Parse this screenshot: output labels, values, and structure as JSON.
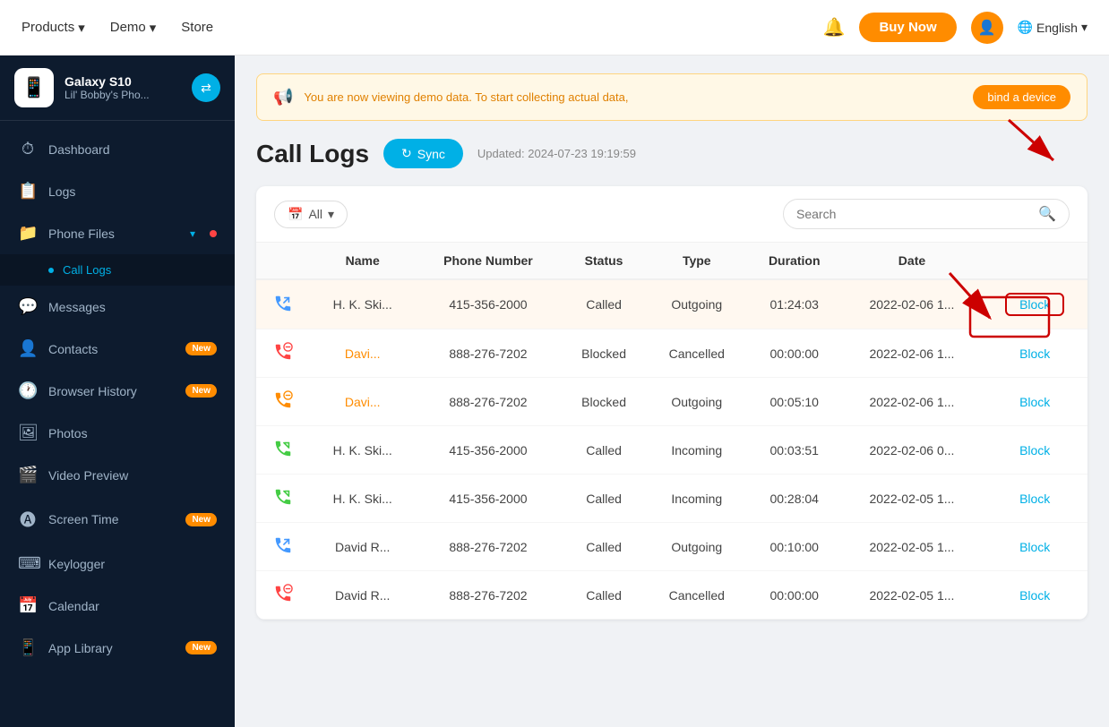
{
  "app": {
    "device_name": "Galaxy S10",
    "device_sub": "Lil' Bobby's Pho...",
    "switch_icon": "↔"
  },
  "top_nav": {
    "products_label": "Products",
    "demo_label": "Demo",
    "store_label": "Store",
    "buy_now_label": "Buy Now",
    "language_label": "English"
  },
  "sidebar": {
    "items": [
      {
        "id": "dashboard",
        "label": "Dashboard",
        "icon": "⏱",
        "badge": ""
      },
      {
        "id": "logs",
        "label": "Logs",
        "icon": "📋",
        "badge": ""
      },
      {
        "id": "phone-files",
        "label": "Phone Files",
        "icon": "📁",
        "badge": ""
      },
      {
        "id": "call-logs",
        "label": "Call Logs",
        "icon": "📞",
        "badge": "",
        "sub": true
      },
      {
        "id": "messages",
        "label": "Messages",
        "icon": "💬",
        "badge": ""
      },
      {
        "id": "contacts",
        "label": "Contacts",
        "icon": "👤",
        "badge": "New"
      },
      {
        "id": "browser-history",
        "label": "Browser History",
        "icon": "🕐",
        "badge": "New"
      },
      {
        "id": "photos",
        "label": "Photos",
        "icon": "🖼",
        "badge": ""
      },
      {
        "id": "video-preview",
        "label": "Video Preview",
        "icon": "🎬",
        "badge": ""
      },
      {
        "id": "screen-time",
        "label": "Screen Time",
        "icon": "🅐",
        "badge": "New"
      },
      {
        "id": "keylogger",
        "label": "Keylogger",
        "icon": "⌨",
        "badge": ""
      },
      {
        "id": "calendar",
        "label": "Calendar",
        "icon": "📅",
        "badge": ""
      },
      {
        "id": "app-library",
        "label": "App Library",
        "icon": "📱",
        "badge": "New"
      }
    ]
  },
  "demo_banner": {
    "text": "You are now viewing demo data. To start collecting actual data,",
    "bind_label": "bind a device"
  },
  "page": {
    "title": "Call Logs",
    "sync_label": "Sync",
    "updated_text": "Updated: 2024-07-23 19:19:59"
  },
  "toolbar": {
    "filter_label": "All",
    "search_placeholder": "Search"
  },
  "table": {
    "columns": [
      "Name",
      "Phone Number",
      "Status",
      "Type",
      "Duration",
      "Date",
      ""
    ],
    "rows": [
      {
        "icon": "outgoing_called",
        "name": "H. K. Ski...",
        "phone": "415-356-2000",
        "status": "Called",
        "type": "Outgoing",
        "duration": "01:24:03",
        "date": "2022-02-06 1...",
        "block": "Block",
        "highlighted": true,
        "name_blocked": false,
        "icon_color": "blue"
      },
      {
        "icon": "incoming_blocked",
        "name": "Davi...",
        "phone": "888-276-7202",
        "status": "Blocked",
        "type": "Cancelled",
        "duration": "00:00:00",
        "date": "2022-02-06 1...",
        "block": "Block",
        "highlighted": false,
        "name_blocked": true,
        "icon_color": "red"
      },
      {
        "icon": "outgoing_blocked",
        "name": "Davi...",
        "phone": "888-276-7202",
        "status": "Blocked",
        "type": "Outgoing",
        "duration": "00:05:10",
        "date": "2022-02-06 1...",
        "block": "Block",
        "highlighted": false,
        "name_blocked": true,
        "icon_color": "orange"
      },
      {
        "icon": "incoming_called",
        "name": "H. K. Ski...",
        "phone": "415-356-2000",
        "status": "Called",
        "type": "Incoming",
        "duration": "00:03:51",
        "date": "2022-02-06 0...",
        "block": "Block",
        "highlighted": false,
        "name_blocked": false,
        "icon_color": "green"
      },
      {
        "icon": "incoming_called",
        "name": "H. K. Ski...",
        "phone": "415-356-2000",
        "status": "Called",
        "type": "Incoming",
        "duration": "00:28:04",
        "date": "2022-02-05 1...",
        "block": "Block",
        "highlighted": false,
        "name_blocked": false,
        "icon_color": "green"
      },
      {
        "icon": "outgoing_called",
        "name": "David R...",
        "phone": "888-276-7202",
        "status": "Called",
        "type": "Outgoing",
        "duration": "00:10:00",
        "date": "2022-02-05 1...",
        "block": "Block",
        "highlighted": false,
        "name_blocked": false,
        "icon_color": "blue"
      },
      {
        "icon": "incoming_blocked",
        "name": "David R...",
        "phone": "888-276-7202",
        "status": "Called",
        "type": "Cancelled",
        "duration": "00:00:00",
        "date": "2022-02-05 1...",
        "block": "Block",
        "highlighted": false,
        "name_blocked": false,
        "icon_color": "red"
      }
    ]
  }
}
